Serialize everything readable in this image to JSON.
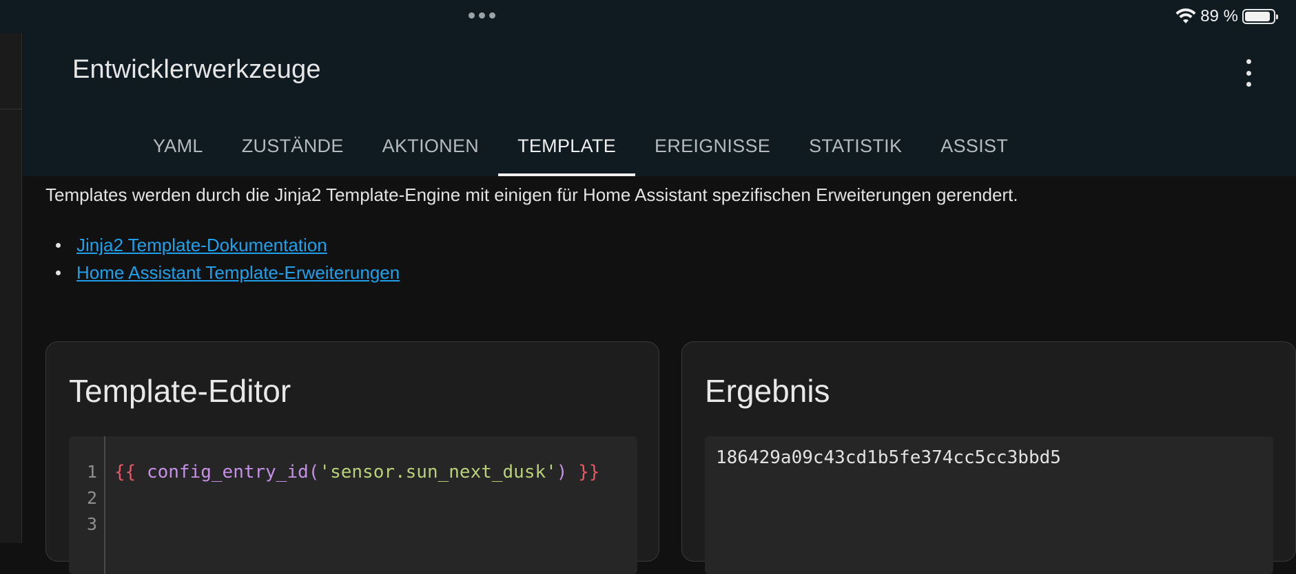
{
  "status_bar": {
    "battery_text": "89 %",
    "battery_level": 0.89
  },
  "header": {
    "title": "Entwicklerwerkzeuge",
    "tabs": [
      {
        "label": "YAML",
        "active": false
      },
      {
        "label": "ZUSTÄNDE",
        "active": false
      },
      {
        "label": "AKTIONEN",
        "active": false
      },
      {
        "label": "TEMPLATE",
        "active": true
      },
      {
        "label": "EREIGNISSE",
        "active": false
      },
      {
        "label": "STATISTIK",
        "active": false
      },
      {
        "label": "ASSIST",
        "active": false
      }
    ]
  },
  "main": {
    "intro": "Templates werden durch die Jinja2 Template-Engine mit einigen für Home Assistant spezifischen Erweiterungen gerendert.",
    "links": [
      {
        "label": "Jinja2 Template-Dokumentation"
      },
      {
        "label": "Home Assistant Template-Erweiterungen"
      }
    ]
  },
  "editor": {
    "title": "Template-Editor",
    "line_numbers": [
      "1",
      "2",
      "3"
    ],
    "code": {
      "open_brace": "{{",
      "function": "config_entry_id(",
      "argument": "'sensor.sun_next_dusk'",
      "close_paren": ")",
      "close_brace": "}}"
    }
  },
  "result": {
    "title": "Ergebnis",
    "value": "186429a09c43cd1b5fe374cc5cc3bbd5"
  },
  "colors": {
    "header_bg": "#101b21",
    "page_bg": "#111111",
    "link": "#1fa0ea",
    "code_brace": "#e85867",
    "code_function": "#c690e8",
    "code_string": "#b9d27a"
  }
}
